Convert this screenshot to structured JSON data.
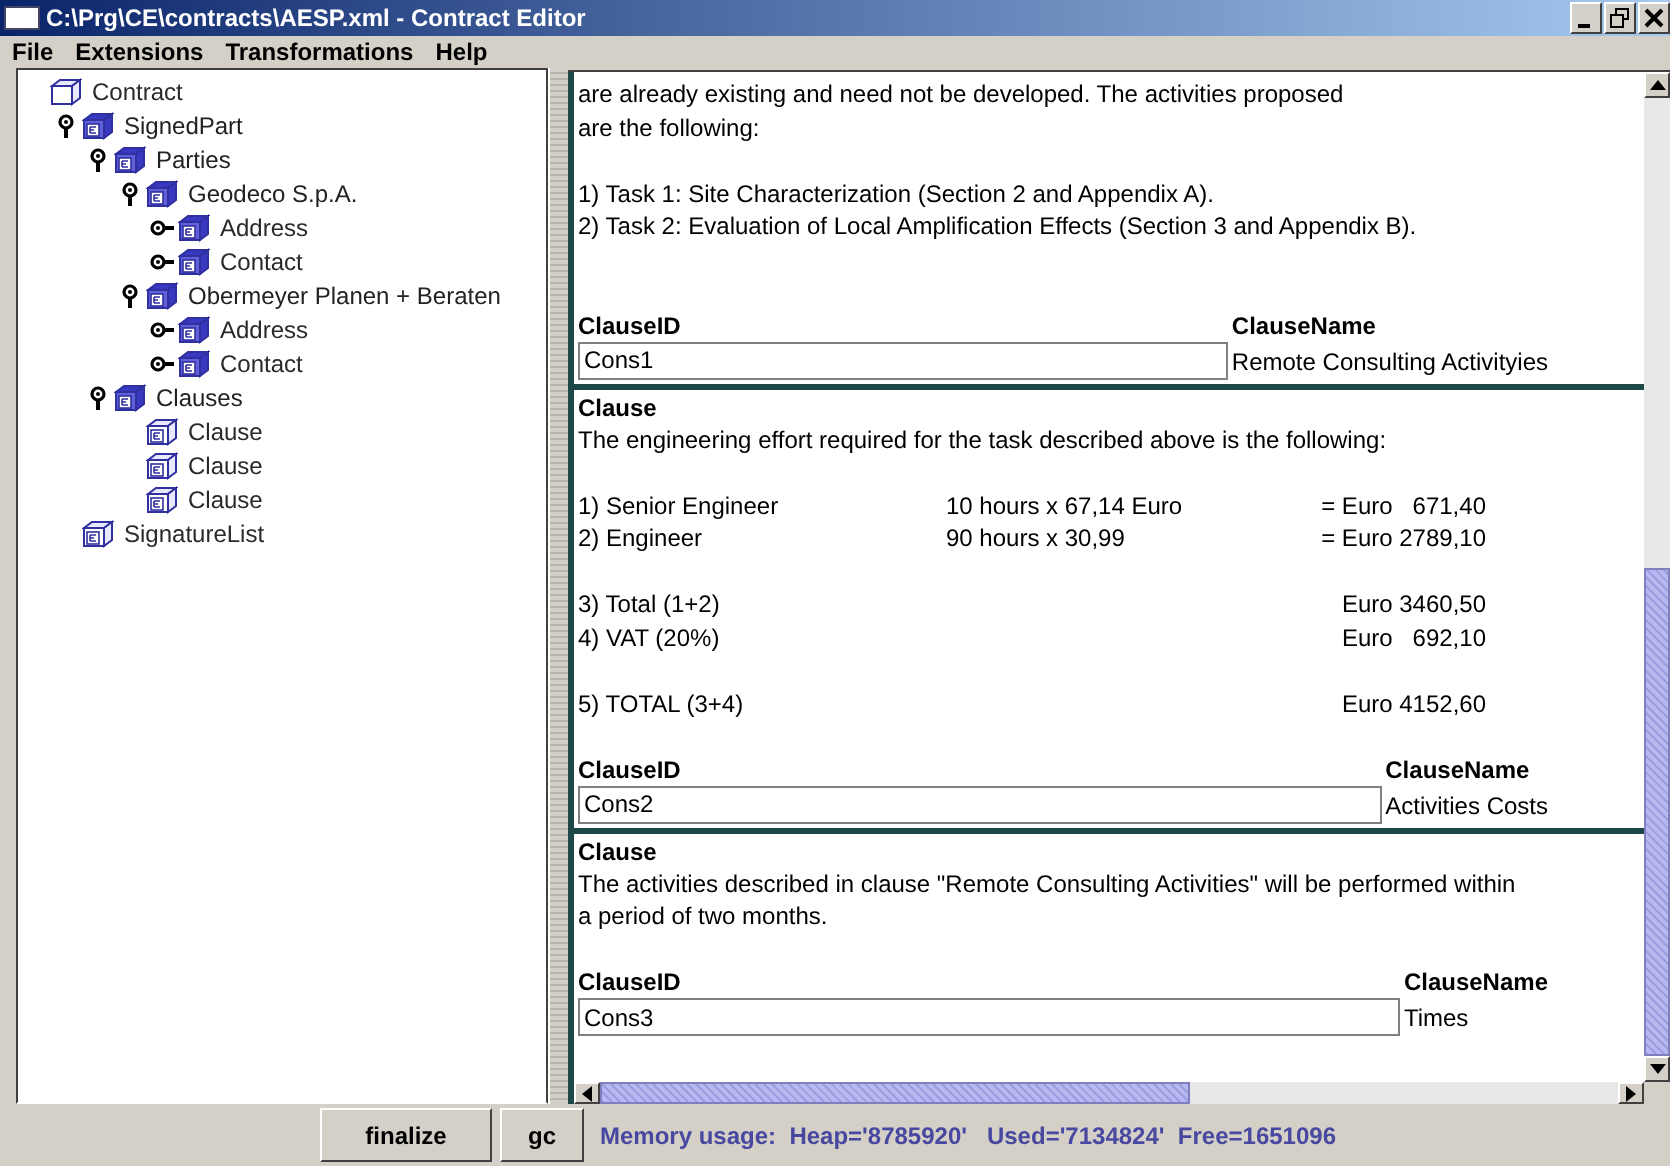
{
  "window": {
    "title": "C:\\Prg\\CE\\contracts\\AESP.xml - Contract Editor"
  },
  "menu": [
    "File",
    "Extensions",
    "Transformations",
    "Help"
  ],
  "tree": [
    {
      "label": "Contract",
      "kind": "root",
      "children": [
        {
          "label": "SignedPart",
          "kind": "branch",
          "expanded": true,
          "children": [
            {
              "label": "Parties",
              "kind": "branch",
              "expanded": true,
              "children": [
                {
                  "label": "Geodeco S.p.A.",
                  "kind": "branch",
                  "expanded": true,
                  "children": [
                    {
                      "label": "Address",
                      "kind": "branch",
                      "expanded": false
                    },
                    {
                      "label": "Contact",
                      "kind": "branch",
                      "expanded": false
                    }
                  ]
                },
                {
                  "label": "Obermeyer Planen + Beraten",
                  "kind": "branch",
                  "expanded": true,
                  "children": [
                    {
                      "label": "Address",
                      "kind": "branch",
                      "expanded": false
                    },
                    {
                      "label": "Contact",
                      "kind": "branch",
                      "expanded": false
                    }
                  ]
                }
              ]
            },
            {
              "label": "Clauses",
              "kind": "branch",
              "expanded": true,
              "children": [
                {
                  "label": "Clause",
                  "kind": "leaf"
                },
                {
                  "label": "Clause",
                  "kind": "leaf"
                },
                {
                  "label": "Clause",
                  "kind": "leaf"
                }
              ]
            }
          ]
        },
        {
          "label": "SignatureList",
          "kind": "leaf"
        }
      ]
    }
  ],
  "clauses": [
    {
      "body": [
        {
          "kind": "text",
          "text": "are already existing and need not be developed. The activities proposed\nare the following:"
        },
        {
          "kind": "gap"
        },
        {
          "kind": "text",
          "text": "1)  Task 1: Site Characterization (Section 2 and Appendix A)."
        },
        {
          "kind": "text",
          "text": "2)  Task 2: Evaluation of Local Amplification Effects (Section 3 and Appendix B)."
        },
        {
          "kind": "gap"
        },
        {
          "kind": "gap"
        }
      ],
      "id_label": "ClauseID",
      "id_value": "Cons1",
      "name_label": "ClauseName",
      "name_value": "Remote Consulting Activityies"
    },
    {
      "heading": "Clause",
      "body": [
        {
          "kind": "text",
          "text": "The engineering effort required for the task described above is the following:"
        },
        {
          "kind": "gap"
        },
        {
          "kind": "cost",
          "cells": [
            "1) Senior Engineer",
            "10 hours x 67,14 Euro",
            "= Euro   671,40"
          ]
        },
        {
          "kind": "cost",
          "cells": [
            "2) Engineer",
            "90 hours x 30,99",
            "= Euro 2789,10"
          ]
        },
        {
          "kind": "gap"
        },
        {
          "kind": "cost",
          "cells": [
            "3) Total (1+2)",
            "",
            "Euro 3460,50"
          ]
        },
        {
          "kind": "cost",
          "cells": [
            "4) VAT (20%)",
            "",
            "Euro   692,10"
          ]
        },
        {
          "kind": "gap"
        },
        {
          "kind": "cost",
          "cells": [
            "5) TOTAL (3+4)",
            "",
            "Euro 4152,60"
          ]
        },
        {
          "kind": "gap"
        }
      ],
      "id_label": "ClauseID",
      "id_value": "Cons2",
      "name_label": "ClauseName",
      "name_value": "Activities Costs"
    },
    {
      "heading": "Clause",
      "body": [
        {
          "kind": "text",
          "text": "The activities described in clause \"Remote Consulting Activities\" will be performed within\na period of two months."
        },
        {
          "kind": "gap"
        }
      ],
      "id_label": "ClauseID",
      "id_value": "Cons3",
      "name_label": "ClauseName",
      "name_value": "Times"
    }
  ],
  "buttons": [
    "finalize",
    "gc"
  ],
  "status": "Memory usage:  Heap='8785920'   Used='7134824'  Free=1651096"
}
